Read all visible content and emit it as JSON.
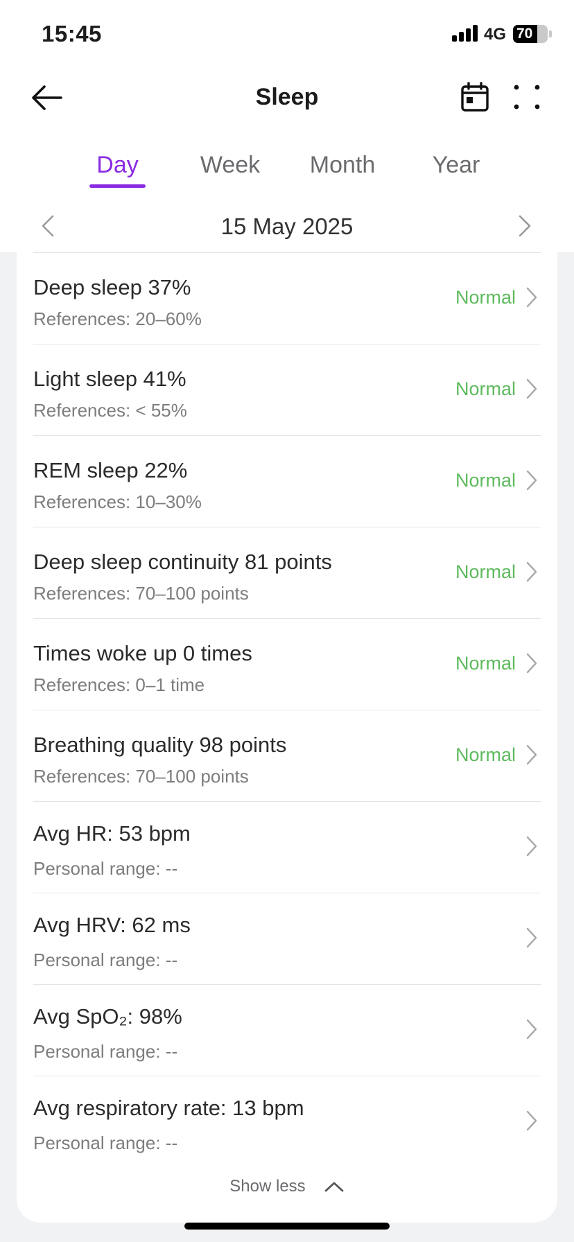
{
  "status_bar": {
    "time": "15:45",
    "network": "4G",
    "battery": "70",
    "battery_level": 0.7
  },
  "header": {
    "title": "Sleep",
    "back_icon": "arrow-left-icon",
    "calendar_icon": "calendar-icon",
    "more_icon": "more-dots-icon"
  },
  "tabs": [
    {
      "label": "Day",
      "active": true
    },
    {
      "label": "Week",
      "active": false
    },
    {
      "label": "Month",
      "active": false
    },
    {
      "label": "Year",
      "active": false
    }
  ],
  "date": {
    "label": "15 May 2025"
  },
  "rows": [
    {
      "title": "Deep sleep 37%",
      "sub": "References: 20–60%",
      "status": "Normal"
    },
    {
      "title": "Light sleep 41%",
      "sub": "References: < 55%",
      "status": "Normal"
    },
    {
      "title": "REM sleep 22%",
      "sub": "References: 10–30%",
      "status": "Normal"
    },
    {
      "title": "Deep sleep continuity 81 points",
      "sub": "References: 70–100 points",
      "status": "Normal"
    },
    {
      "title": "Times woke up 0 times",
      "sub": "References: 0–1 time",
      "status": "Normal"
    },
    {
      "title": "Breathing quality 98 points",
      "sub": "References: 70–100 points",
      "status": "Normal"
    },
    {
      "title": "Avg HR: 53 bpm",
      "sub": "Personal range: --",
      "status": ""
    },
    {
      "title": "Avg HRV: 62 ms",
      "sub": "Personal range: --",
      "status": ""
    },
    {
      "title": "Avg SpO₂: 98%",
      "sub": "Personal range: --",
      "status": ""
    },
    {
      "title": "Avg respiratory rate: 13 bpm",
      "sub": "Personal range: --",
      "status": ""
    }
  ],
  "show_less": {
    "label": "Show less"
  },
  "colors": {
    "accent": "#8a2be2",
    "normal": "#5dba5d",
    "background": "#f1f2f4"
  }
}
